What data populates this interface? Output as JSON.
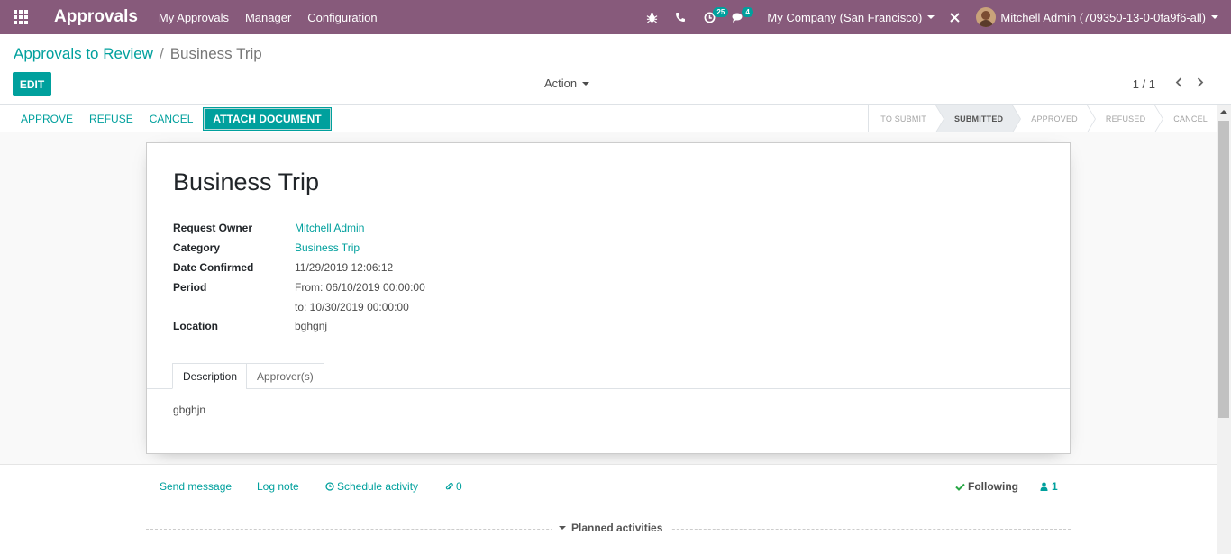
{
  "navbar": {
    "brand": "Approvals",
    "menu": [
      "My Approvals",
      "Manager",
      "Configuration"
    ],
    "activity_count": "25",
    "message_count": "4",
    "company": "My Company (San Francisco)",
    "user": "Mitchell Admin (709350-13-0-0fa9f6-all)",
    "color": "#875a7b"
  },
  "breadcrumb": {
    "parent": "Approvals to Review",
    "separator": "/",
    "current": "Business Trip"
  },
  "control_panel": {
    "edit_label": "EDIT",
    "action_label": "Action",
    "pager_value": "1 / 1"
  },
  "status_buttons": {
    "approve": "APPROVE",
    "refuse": "REFUSE",
    "cancel": "CANCEL",
    "attach": "ATTACH DOCUMENT"
  },
  "stages": [
    {
      "label": "TO SUBMIT",
      "active": false
    },
    {
      "label": "SUBMITTED",
      "active": true
    },
    {
      "label": "APPROVED",
      "active": false
    },
    {
      "label": "REFUSED",
      "active": false
    },
    {
      "label": "CANCEL",
      "active": false
    }
  ],
  "record": {
    "title": "Business Trip",
    "fields": {
      "owner_label": "Request Owner",
      "owner_value": "Mitchell Admin",
      "category_label": "Category",
      "category_value": "Business Trip",
      "date_label": "Date Confirmed",
      "date_value": "11/29/2019 12:06:12",
      "period_label": "Period",
      "period_from": "From: 06/10/2019 00:00:00",
      "period_to": "to: 10/30/2019 00:00:00",
      "location_label": "Location",
      "location_value": "bghgnj"
    },
    "tabs": [
      "Description",
      "Approver(s)"
    ],
    "description": "gbghjn"
  },
  "chatter": {
    "send_message": "Send message",
    "log_note": "Log note",
    "schedule_activity": "Schedule activity",
    "attachments_count": "0",
    "following": "Following",
    "followers_count": "1",
    "planned_activities": "Planned activities"
  },
  "colors": {
    "accent": "#00a09d",
    "brand": "#875a7b"
  }
}
